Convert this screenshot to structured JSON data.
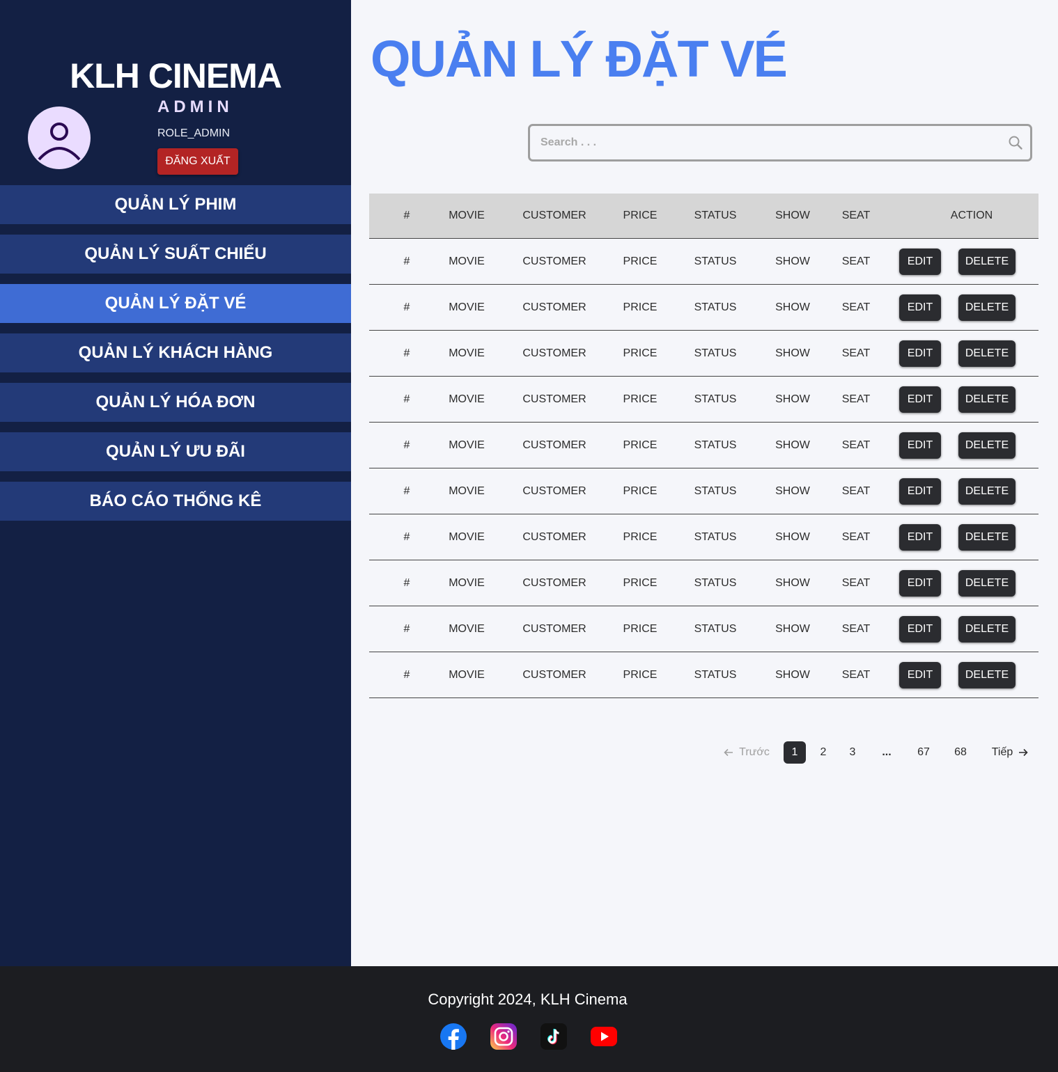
{
  "sidebar": {
    "brand": "KLH CINEMA",
    "admin_name": "ADMIN",
    "role": "ROLE_ADMIN",
    "logout_label": "ĐĂNG XUẤT",
    "nav": [
      {
        "label": "QUẢN LÝ PHIM",
        "active": false
      },
      {
        "label": "QUẢN LÝ SUẤT CHIẾU",
        "active": false
      },
      {
        "label": "QUẢN LÝ ĐẶT VÉ",
        "active": true
      },
      {
        "label": "QUẢN LÝ KHÁCH HÀNG",
        "active": false
      },
      {
        "label": "QUẢN LÝ HÓA ĐƠN",
        "active": false
      },
      {
        "label": "QUẢN LÝ ƯU ĐÃI",
        "active": false
      },
      {
        "label": "BÁO CÁO THỐNG KÊ",
        "active": false
      }
    ]
  },
  "main": {
    "title": "QUẢN LÝ ĐẶT VÉ",
    "search": {
      "placeholder": "Search . . .",
      "value": ""
    }
  },
  "table": {
    "headers": {
      "idx": "#",
      "movie": "MOVIE",
      "customer": "CUSTOMER",
      "price": "PRICE",
      "status": "STATUS",
      "show": "SHOW",
      "seat": "SEAT",
      "action": "ACTION"
    },
    "rows": [
      {
        "idx": "#",
        "movie": "MOVIE",
        "customer": "CUSTOMER",
        "price": "PRICE",
        "status": "STATUS",
        "show": "SHOW",
        "seat": "SEAT"
      },
      {
        "idx": "#",
        "movie": "MOVIE",
        "customer": "CUSTOMER",
        "price": "PRICE",
        "status": "STATUS",
        "show": "SHOW",
        "seat": "SEAT"
      },
      {
        "idx": "#",
        "movie": "MOVIE",
        "customer": "CUSTOMER",
        "price": "PRICE",
        "status": "STATUS",
        "show": "SHOW",
        "seat": "SEAT"
      },
      {
        "idx": "#",
        "movie": "MOVIE",
        "customer": "CUSTOMER",
        "price": "PRICE",
        "status": "STATUS",
        "show": "SHOW",
        "seat": "SEAT"
      },
      {
        "idx": "#",
        "movie": "MOVIE",
        "customer": "CUSTOMER",
        "price": "PRICE",
        "status": "STATUS",
        "show": "SHOW",
        "seat": "SEAT"
      },
      {
        "idx": "#",
        "movie": "MOVIE",
        "customer": "CUSTOMER",
        "price": "PRICE",
        "status": "STATUS",
        "show": "SHOW",
        "seat": "SEAT"
      },
      {
        "idx": "#",
        "movie": "MOVIE",
        "customer": "CUSTOMER",
        "price": "PRICE",
        "status": "STATUS",
        "show": "SHOW",
        "seat": "SEAT"
      },
      {
        "idx": "#",
        "movie": "MOVIE",
        "customer": "CUSTOMER",
        "price": "PRICE",
        "status": "STATUS",
        "show": "SHOW",
        "seat": "SEAT"
      },
      {
        "idx": "#",
        "movie": "MOVIE",
        "customer": "CUSTOMER",
        "price": "PRICE",
        "status": "STATUS",
        "show": "SHOW",
        "seat": "SEAT"
      },
      {
        "idx": "#",
        "movie": "MOVIE",
        "customer": "CUSTOMER",
        "price": "PRICE",
        "status": "STATUS",
        "show": "SHOW",
        "seat": "SEAT"
      }
    ],
    "edit_label": "EDIT",
    "delete_label": "DELETE"
  },
  "pagination": {
    "prev": "Trước",
    "next": "Tiếp",
    "pages": [
      "1",
      "2",
      "3",
      "67",
      "68"
    ],
    "ellipsis": "...",
    "current": "1"
  },
  "footer": {
    "copyright": "Copyright 2024, KLH Cinema",
    "social": [
      "facebook-icon",
      "instagram-icon",
      "tiktok-icon",
      "youtube-icon"
    ]
  },
  "colors": {
    "sidebar_bg": "#132044",
    "nav_bg": "#233a78",
    "nav_active": "#3f6cd4",
    "title": "#4a7ff0",
    "logout": "#b32424",
    "footer_bg": "#1c1d21"
  }
}
